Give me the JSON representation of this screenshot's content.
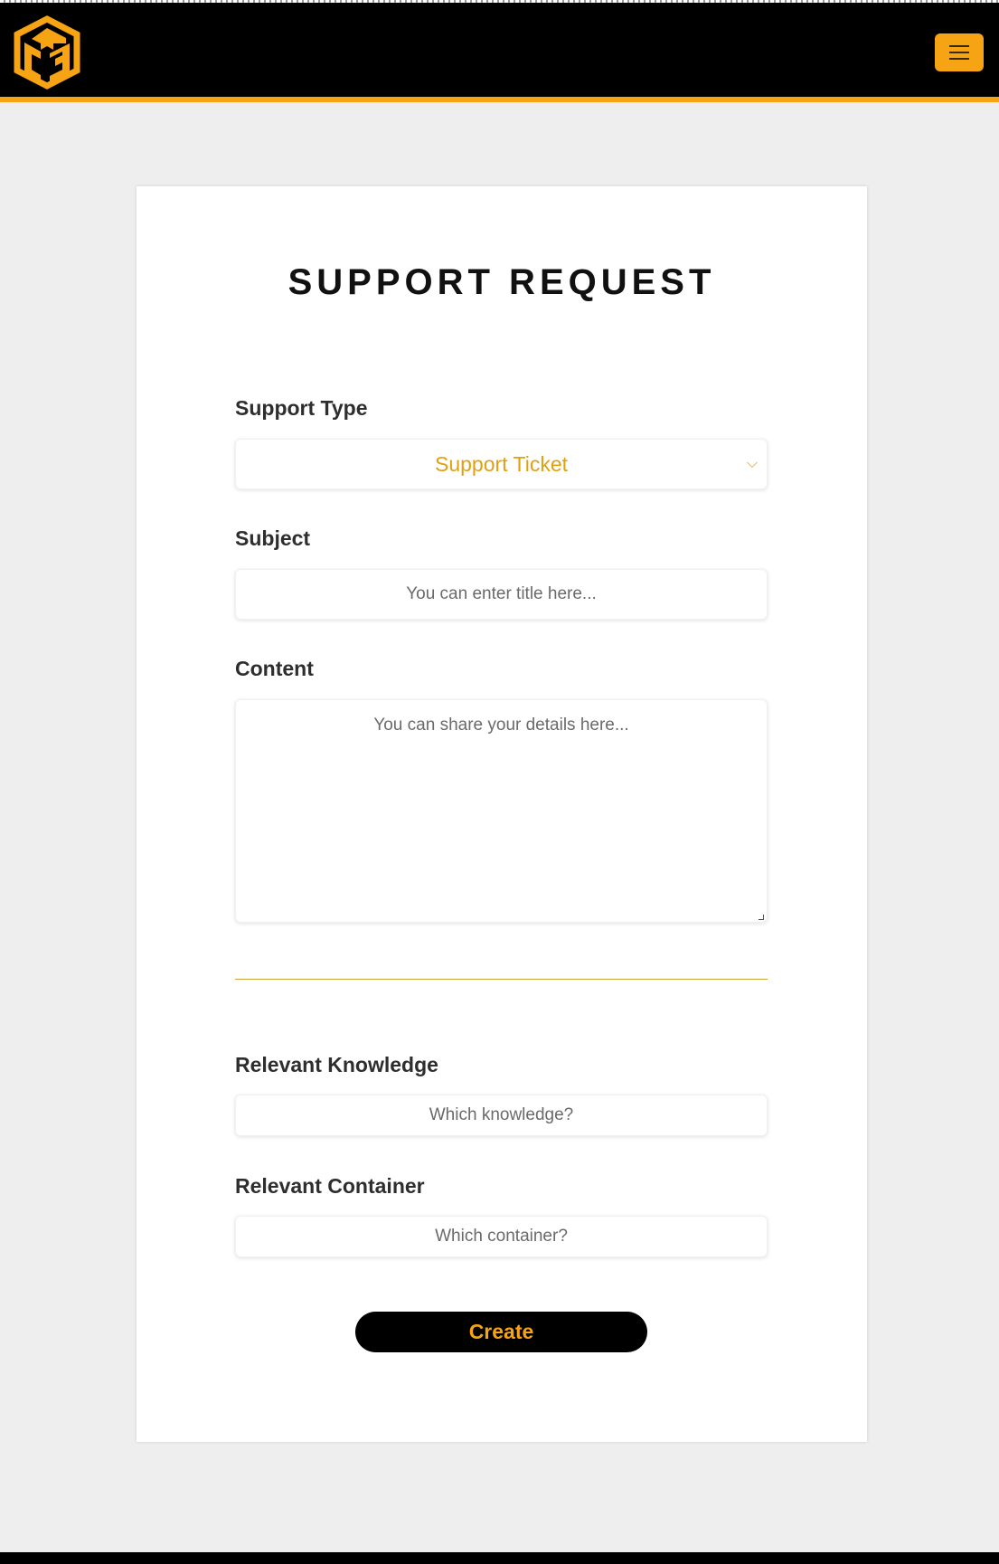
{
  "header": {
    "logo_icon": "cube-cg-logo-icon",
    "menu_icon": "hamburger-menu-icon",
    "accent_color": "#f7a414"
  },
  "form": {
    "title": "SUPPORT REQUEST",
    "support_type": {
      "label": "Support Type",
      "selected": "Support Ticket",
      "chevron_icon": "chevron-down-icon"
    },
    "subject": {
      "label": "Subject",
      "placeholder": "You can enter title here..."
    },
    "content": {
      "label": "Content",
      "placeholder": "You can share your details here..."
    },
    "relevant_knowledge": {
      "label": "Relevant Knowledge",
      "placeholder": "Which knowledge?"
    },
    "relevant_container": {
      "label": "Relevant Container",
      "placeholder": "Which container?"
    },
    "submit_label": "Create"
  }
}
